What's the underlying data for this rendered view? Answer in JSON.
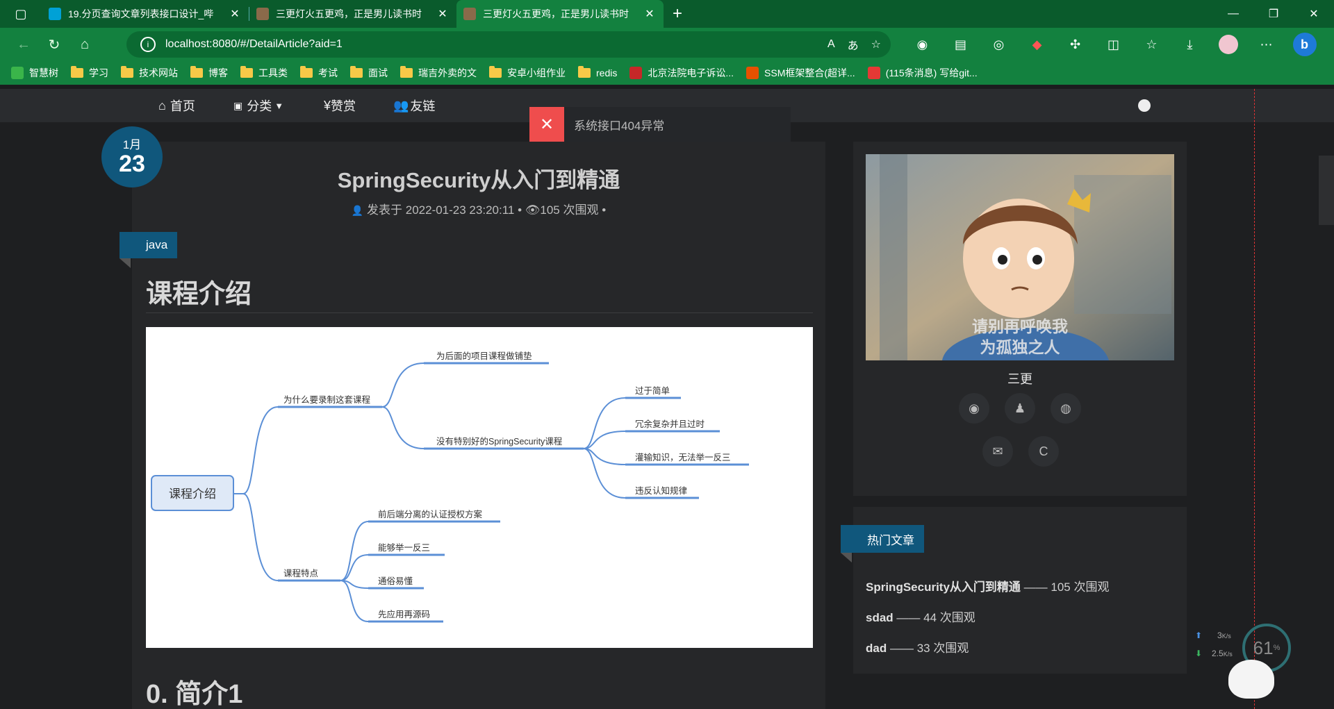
{
  "browser": {
    "tabs": [
      {
        "title": "19.分页查询文章列表接口设计_哔",
        "active": false,
        "favicon_color": "#00a1d6"
      },
      {
        "title": "三更灯火五更鸡，正是男儿读书时",
        "active": false,
        "favicon_color": "#8a6a4a"
      },
      {
        "title": "三更灯火五更鸡，正是男儿读书时",
        "active": true,
        "favicon_color": "#8a6a4a"
      }
    ],
    "url": "localhost:8080/#/DetailArticle?aid=1",
    "bookmarks": [
      {
        "label": "智慧树",
        "type": "site",
        "color": "#3ab54a"
      },
      {
        "label": "学习",
        "type": "folder"
      },
      {
        "label": "技术网站",
        "type": "folder"
      },
      {
        "label": "博客",
        "type": "folder"
      },
      {
        "label": "工具类",
        "type": "folder"
      },
      {
        "label": "考试",
        "type": "folder"
      },
      {
        "label": "面试",
        "type": "folder"
      },
      {
        "label": "瑞吉外卖的文",
        "type": "folder"
      },
      {
        "label": "安卓小组作业",
        "type": "folder"
      },
      {
        "label": "redis",
        "type": "folder"
      },
      {
        "label": "北京法院电子诉讼...",
        "type": "site",
        "color": "#c62828"
      },
      {
        "label": "SSM框架整合(超详...",
        "type": "site",
        "color": "#e65100"
      },
      {
        "label": "(115条消息) 写给git...",
        "type": "site",
        "color": "#e53935"
      }
    ]
  },
  "nav": {
    "home": "首页",
    "category": "分类",
    "reward": "赞赏",
    "links": "友链"
  },
  "toast": {
    "message": "系统接口404异常"
  },
  "article": {
    "month": "1月",
    "day": "23",
    "title": "SpringSecurity从入门到精通",
    "posted_label": "发表于",
    "posted_time": "2022-01-23 23:20:11",
    "views": "105 次围观",
    "tag": "java",
    "heading1": "课程介绍",
    "heading2": "0. 简介1",
    "mindmap": {
      "root": "课程介绍",
      "why": "为什么要录制这套课程",
      "paving": "为后面的项目课程做铺垫",
      "no_good": "没有特别好的SpringSecurity课程",
      "too_simple": "过于简单",
      "redundant": "冗余复杂并且过时",
      "cramming": "灌输知识，无法举一反三",
      "violate": "违反认知规律",
      "features": "课程特点",
      "f1": "前后端分离的认证授权方案",
      "f2": "能够举一反三",
      "f3": "通俗易懂",
      "f4": "先应用再源码"
    }
  },
  "profile": {
    "caption_line1": "请别再呼唤我",
    "caption_line2": "为孤独之人",
    "name": "三更"
  },
  "hot": {
    "title": "热门文章",
    "items": [
      {
        "name": "SpringSecurity从入门到精通",
        "views": "—— 105 次围观"
      },
      {
        "name": "sdad",
        "views": "—— 44 次围观"
      },
      {
        "name": "dad",
        "views": "—— 33 次围观"
      }
    ]
  },
  "monitor": {
    "up": "3",
    "down": "2.5",
    "unit": "K/s",
    "percent": "61",
    "pct_sign": "%"
  }
}
